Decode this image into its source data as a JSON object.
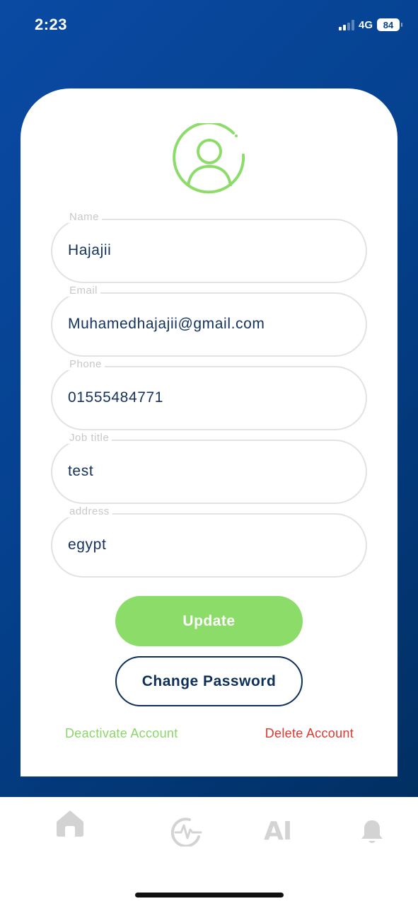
{
  "status_bar": {
    "time": "2:23",
    "network": "4G",
    "battery": "84"
  },
  "profile": {
    "avatar_icon": "user-circle-icon",
    "fields": [
      {
        "label": "Name",
        "value": "Hajajii"
      },
      {
        "label": "Email",
        "value": "Muhamedhajajii@gmail.com"
      },
      {
        "label": "Phone",
        "value": "01555484771"
      },
      {
        "label": "Job title",
        "value": "test"
      },
      {
        "label": "address",
        "value": "egypt"
      }
    ]
  },
  "actions": {
    "update_label": "Update",
    "change_password_label": "Change Password",
    "deactivate_label": "Deactivate Account",
    "delete_label": "Delete Account"
  },
  "bottom_nav": {
    "home_icon": "home-icon",
    "pulse_icon": "pulse-icon",
    "ai_label": "AI",
    "bell_icon": "bell-icon"
  },
  "colors": {
    "primary_blue": "#05418f",
    "accent_green": "#8cdc6a",
    "danger_red": "#e2362e",
    "text_navy": "#13315c"
  }
}
